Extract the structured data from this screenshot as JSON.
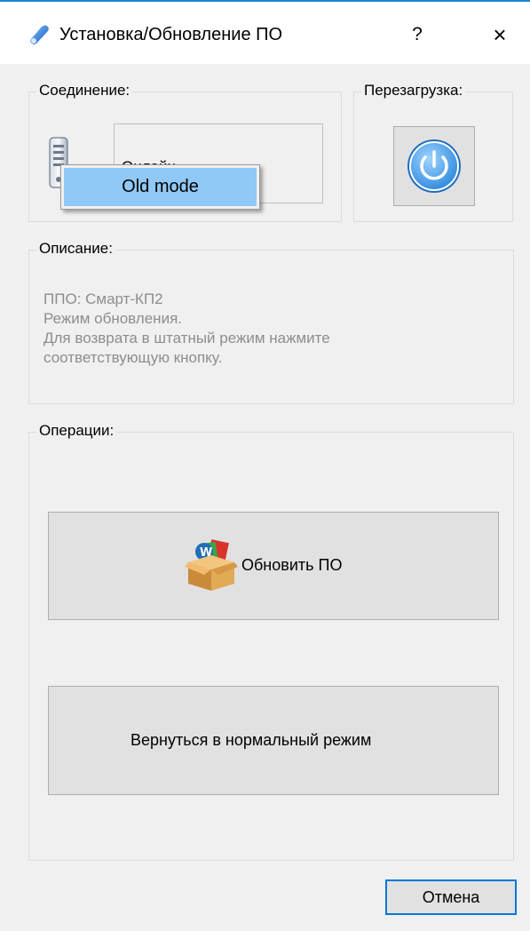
{
  "window": {
    "title": "Установка/Обновление ПО",
    "help_label": "?",
    "close_label": "×"
  },
  "connection": {
    "label": "Соединение:",
    "status_text": "Онлайн",
    "popup_item": "Old mode"
  },
  "reboot": {
    "label": "Перезагрузка:"
  },
  "description": {
    "label": "Описание:",
    "lines": [
      "ППО: Смарт-КП2",
      "Режим обновления.",
      "Для возврата в штатный режим нажмите",
      "соответствующую кнопку."
    ]
  },
  "operations": {
    "label": "Операции:",
    "update_button": "Обновить ПО",
    "return_button": "Вернуться в нормальный режим"
  },
  "footer": {
    "cancel_button": "Отмена"
  },
  "colors": {
    "accent": "#1883d7",
    "popup_highlight": "#90c8f6",
    "power_blue": "#3a9be6"
  }
}
